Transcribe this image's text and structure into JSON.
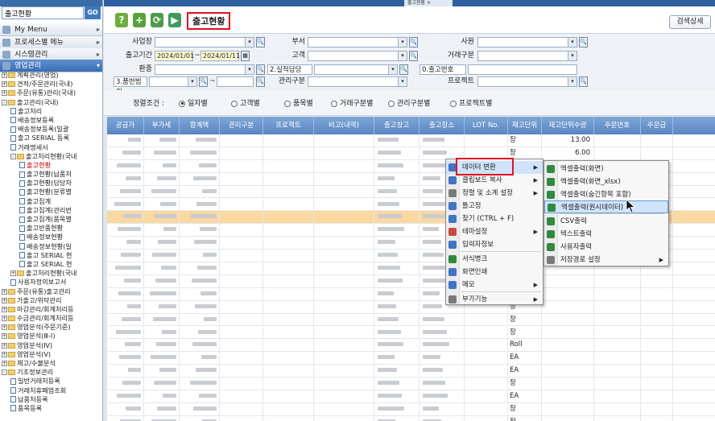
{
  "sidebar": {
    "search_value": "출고현황",
    "go_label": "GO",
    "menus": [
      {
        "label": "My Menu",
        "active": false
      },
      {
        "label": "프로세스별 메뉴",
        "active": false
      },
      {
        "label": "시스템관리",
        "active": false
      },
      {
        "label": "영업관리",
        "active": true
      }
    ],
    "tree": [
      {
        "label": "계획관리(영업)",
        "lvl": 0,
        "type": "folder",
        "tg": "+"
      },
      {
        "label": "견적/주문관리(국내)",
        "lvl": 0,
        "type": "folder",
        "tg": "+"
      },
      {
        "label": "주문(유통)관리(국내)",
        "lvl": 0,
        "type": "folder",
        "tg": "+"
      },
      {
        "label": "출고관리(국내)",
        "lvl": 0,
        "type": "folder",
        "tg": "-"
      },
      {
        "label": "출고처리",
        "lvl": 1,
        "type": "doc"
      },
      {
        "label": "배송정보등록",
        "lvl": 1,
        "type": "doc"
      },
      {
        "label": "배송정보등록(일괄",
        "lvl": 1,
        "type": "doc"
      },
      {
        "label": "출고 SERIAL 등록",
        "lvl": 1,
        "type": "doc"
      },
      {
        "label": "거래명세서",
        "lvl": 1,
        "type": "doc"
      },
      {
        "label": "출고처리현황(국내",
        "lvl": 1,
        "type": "folder",
        "tg": "-"
      },
      {
        "label": "출고현황",
        "lvl": 2,
        "type": "doc",
        "sel": true
      },
      {
        "label": "출고현황(납품처",
        "lvl": 2,
        "type": "doc"
      },
      {
        "label": "출고현황(담당자",
        "lvl": 2,
        "type": "doc"
      },
      {
        "label": "출고현황(분류별",
        "lvl": 2,
        "type": "doc"
      },
      {
        "label": "출고집계",
        "lvl": 2,
        "type": "doc"
      },
      {
        "label": "출고집계(관리번",
        "lvl": 2,
        "type": "doc"
      },
      {
        "label": "출고집계(품목별",
        "lvl": 2,
        "type": "doc"
      },
      {
        "label": "출고반품현황",
        "lvl": 2,
        "type": "doc"
      },
      {
        "label": "배송정보현황",
        "lvl": 2,
        "type": "doc"
      },
      {
        "label": "배송정보현황(일",
        "lvl": 2,
        "type": "doc"
      },
      {
        "label": "출고 SERIAL 현",
        "lvl": 2,
        "type": "doc"
      },
      {
        "label": "출고 SERIAL 현",
        "lvl": 2,
        "type": "doc"
      },
      {
        "label": "출고처리현황(국내",
        "lvl": 1,
        "type": "folder",
        "tg": "+"
      },
      {
        "label": "사용자정의보고서",
        "lvl": 1,
        "type": "doc"
      },
      {
        "label": "주문(유통)출고관리",
        "lvl": 0,
        "type": "folder",
        "tg": "+"
      },
      {
        "label": "가출고/위탁관리",
        "lvl": 0,
        "type": "folder",
        "tg": "+"
      },
      {
        "label": "마감관리/회계처리등",
        "lvl": 0,
        "type": "folder",
        "tg": "+"
      },
      {
        "label": "수금관리/회계처리등",
        "lvl": 0,
        "type": "folder",
        "tg": "+"
      },
      {
        "label": "영업분석(주문기준)",
        "lvl": 0,
        "type": "folder",
        "tg": "+"
      },
      {
        "label": "영업분석(Ⅲ-Ⅰ)",
        "lvl": 0,
        "type": "folder",
        "tg": "+"
      },
      {
        "label": "영업분석(Ⅳ)",
        "lvl": 0,
        "type": "folder",
        "tg": "+"
      },
      {
        "label": "영업분석(Ⅴ)",
        "lvl": 0,
        "type": "folder",
        "tg": "+"
      },
      {
        "label": "재고/수불분석",
        "lvl": 0,
        "type": "folder",
        "tg": "+"
      },
      {
        "label": "기초정보관리",
        "lvl": 0,
        "type": "folder",
        "tg": "-"
      },
      {
        "label": "일반거래처등록",
        "lvl": 1,
        "type": "doc"
      },
      {
        "label": "거래처휴폐업조회",
        "lvl": 1,
        "type": "doc"
      },
      {
        "label": "납품처등록",
        "lvl": 1,
        "type": "doc"
      },
      {
        "label": "품목등록",
        "lvl": 1,
        "type": "doc"
      }
    ]
  },
  "toolbar": {
    "title": "출고현황",
    "detail_btn": "검색상세"
  },
  "filter": {
    "biz_label": "사업장",
    "dept_label": "부서",
    "emp_label": "사원",
    "period_label": "출고기간",
    "date_from": "2024/01/01",
    "date_to": "2024/01/11",
    "tilde": "~",
    "cust_label": "고객",
    "deal_label": "거래구분",
    "currency_label": "환종",
    "owner_label": "2.실적담당",
    "outno_label": "0.출고번호",
    "item_label": "3.품번범위",
    "mgmt_label": "관리구분",
    "proj_label": "프로젝트"
  },
  "sort": {
    "label": "정렬조건 :",
    "options": [
      {
        "label": "일자별",
        "on": true
      },
      {
        "label": "고객별",
        "on": false
      },
      {
        "label": "품목별",
        "on": false
      },
      {
        "label": "거래구분별",
        "on": false
      },
      {
        "label": "관리구분별",
        "on": false
      },
      {
        "label": "프로젝트별",
        "on": false
      }
    ]
  },
  "grid": {
    "headers": [
      "공급가",
      "부가세",
      "합계액",
      "관리구분",
      "프로젝트",
      "비고(내역)",
      "출고창고",
      "출고장소",
      "LOT No.",
      "재고단위",
      "재고단위수량",
      "주문번호",
      "주문급"
    ],
    "rows": [
      {
        "unit": "장",
        "qty": "13.00"
      },
      {
        "unit": "장",
        "qty": "6.00"
      },
      {
        "unit": "",
        "qty": ""
      },
      {
        "unit": "",
        "qty": ""
      },
      {
        "unit": "",
        "qty": ""
      },
      {
        "unit": "",
        "qty": ""
      },
      {
        "unit": "",
        "qty": ""
      },
      {
        "unit": "",
        "qty": ""
      },
      {
        "unit": "",
        "qty": ""
      },
      {
        "unit": "",
        "qty": ""
      },
      {
        "unit": "",
        "qty": ""
      },
      {
        "unit": "",
        "qty": ""
      },
      {
        "unit": "",
        "qty": ""
      },
      {
        "unit": "장",
        "qty": ""
      },
      {
        "unit": "장",
        "qty": ""
      },
      {
        "unit": "장",
        "qty": ""
      },
      {
        "unit": "Roll",
        "qty": ""
      },
      {
        "unit": "EA",
        "qty": ""
      },
      {
        "unit": "EA",
        "qty": ""
      },
      {
        "unit": "장",
        "qty": ""
      },
      {
        "unit": "EA",
        "qty": ""
      },
      {
        "unit": "장",
        "qty": ""
      },
      {
        "unit": "장",
        "qty": ""
      }
    ]
  },
  "menu1": {
    "items": [
      {
        "label": "데이터 변환",
        "sub": true,
        "icon": "convert-icon"
      },
      {
        "label": "클립보드 복사",
        "sub": true,
        "icon": "clipboard-icon"
      },
      {
        "label": "정렬 및 소계 설정",
        "sub": true,
        "icon": "sort-icon"
      },
      {
        "label": "틀고정",
        "sub": false,
        "icon": "freeze-icon"
      },
      {
        "label": "찾기 (CTRL + F)",
        "sub": false,
        "icon": "find-icon"
      },
      {
        "label": "테마설정",
        "sub": true,
        "icon": "theme-icon"
      },
      {
        "label": "입력자정보",
        "sub": false,
        "icon": "user-info-icon"
      },
      {
        "label": "서식병크",
        "sub": false,
        "icon": "format-icon"
      },
      {
        "label": "화면인쇄",
        "sub": false,
        "icon": "print-icon"
      },
      {
        "label": "메모",
        "sub": true,
        "icon": "memo-icon"
      },
      {
        "label": "부가기능",
        "sub": true,
        "icon": "addon-icon"
      }
    ]
  },
  "menu2": {
    "items": [
      {
        "label": "엑셀출력(화면)",
        "icon": "excel-icon"
      },
      {
        "label": "엑셀출력(화면_xlsx)",
        "icon": "excel-icon"
      },
      {
        "label": "엑셀출력(숨긴항목 포함)",
        "icon": "excel-icon"
      },
      {
        "label": "엑셀출력(원시데이터)",
        "icon": "excel-icon"
      },
      {
        "label": "CSV출력",
        "icon": "csv-icon"
      },
      {
        "label": "텍스트출력",
        "icon": "text-icon"
      },
      {
        "label": "사용자출력",
        "icon": "user-output-icon"
      },
      {
        "label": "저장경로 설정",
        "icon": "folder-settings-icon",
        "sub": true
      }
    ]
  },
  "colors": {
    "accent": "#e2111b",
    "header": "#5a86c2",
    "highlight_row": "#fbd8a0",
    "menu_hover": "#cfe4fb"
  }
}
